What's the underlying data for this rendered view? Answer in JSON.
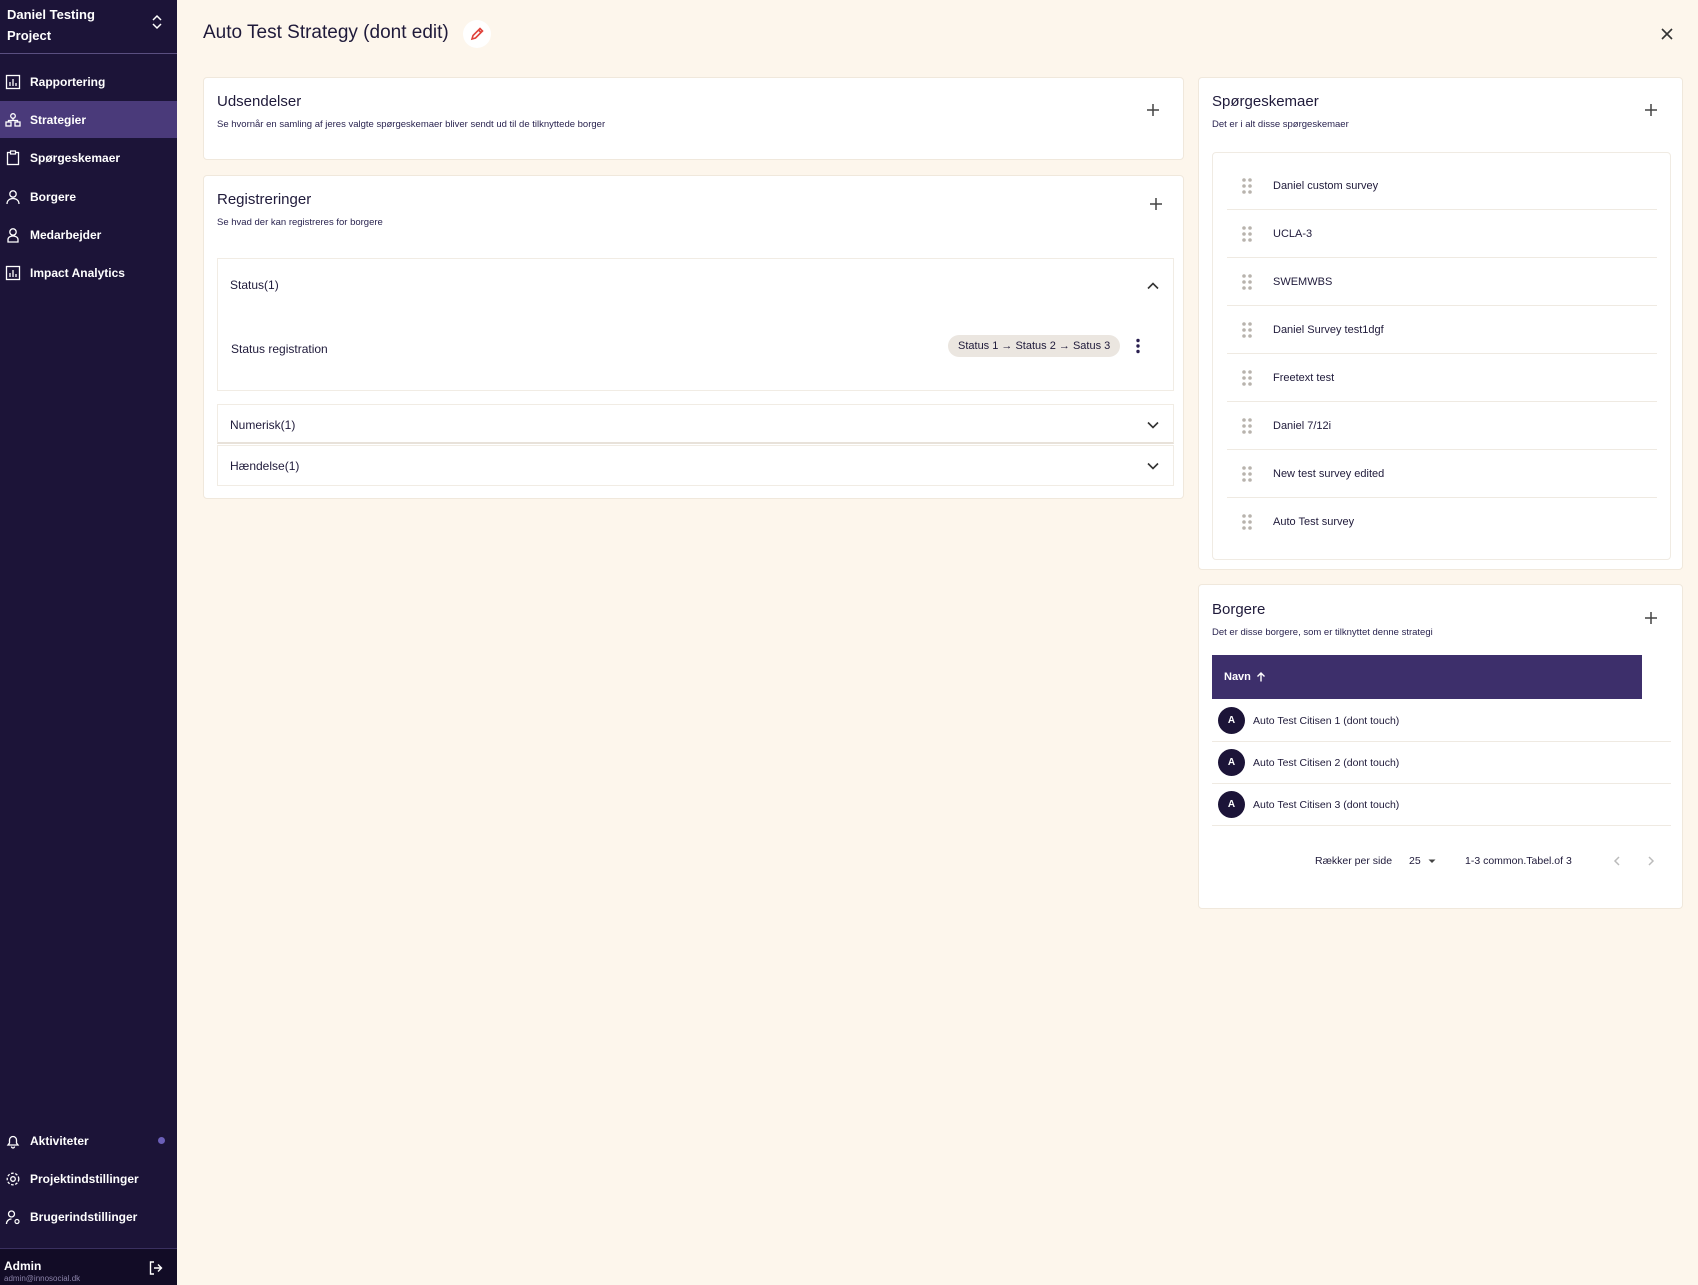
{
  "sidebar": {
    "project_name": "Daniel Testing Project",
    "nav": [
      {
        "label": "Rapportering",
        "icon": "chart-icon"
      },
      {
        "label": "Strategier",
        "icon": "strategy-icon",
        "active": true
      },
      {
        "label": "Spørgeskemaer",
        "icon": "clipboard-icon"
      },
      {
        "label": "Borgere",
        "icon": "user-icon"
      },
      {
        "label": "Medarbejder",
        "icon": "employee-icon"
      },
      {
        "label": "Impact Analytics",
        "icon": "chart-icon"
      }
    ],
    "bottom_nav": [
      {
        "label": "Aktiviteter",
        "icon": "bell-icon"
      },
      {
        "label": "Projektindstillinger",
        "icon": "gear-icon"
      },
      {
        "label": "Brugerindstillinger",
        "icon": "user-gear-icon"
      }
    ],
    "user": {
      "name": "Admin",
      "email": "admin@innosocial.dk"
    }
  },
  "header": {
    "title": "Auto Test Strategy (dont edit)"
  },
  "udsendelser": {
    "title": "Udsendelser",
    "subtitle": "Se hvornår en samling af jeres valgte spørgeskemaer bliver sendt ud til de tilknyttede borger"
  },
  "registreringer": {
    "title": "Registreringer",
    "subtitle": "Se hvad der kan registreres for borgere",
    "sections": [
      {
        "label": "Status(1)",
        "expanded": true
      },
      {
        "label": "Numerisk(1)",
        "expanded": false
      },
      {
        "label": "Hændelse(1)",
        "expanded": false
      }
    ],
    "status_item": {
      "label": "Status registration",
      "flow": "Status 1 → Status 2 → Satus 3"
    }
  },
  "surveys": {
    "title": "Spørgeskemaer",
    "subtitle": "Det er i alt disse spørgeskemaer",
    "items": [
      "Daniel custom survey",
      "UCLA-3",
      "SWEMWBS",
      "Daniel Survey test1dgf",
      "Freetext test",
      "Daniel 7/12i",
      "New test survey edited",
      "Auto Test survey"
    ]
  },
  "citizens": {
    "title": "Borgere",
    "subtitle": "Det er disse borgere, som er tilknyttet denne strategi",
    "column_header": "Navn",
    "rows": [
      {
        "initial": "A",
        "name": "Auto Test Citisen 1 (dont touch)"
      },
      {
        "initial": "A",
        "name": "Auto Test Citisen 2 (dont touch)"
      },
      {
        "initial": "A",
        "name": "Auto Test Citisen 3 (dont touch)"
      }
    ],
    "pagination": {
      "rows_per_page_label": "Rækker per side",
      "rows_per_page": "25",
      "range": "1-3 common.Tabel.of 3"
    }
  }
}
